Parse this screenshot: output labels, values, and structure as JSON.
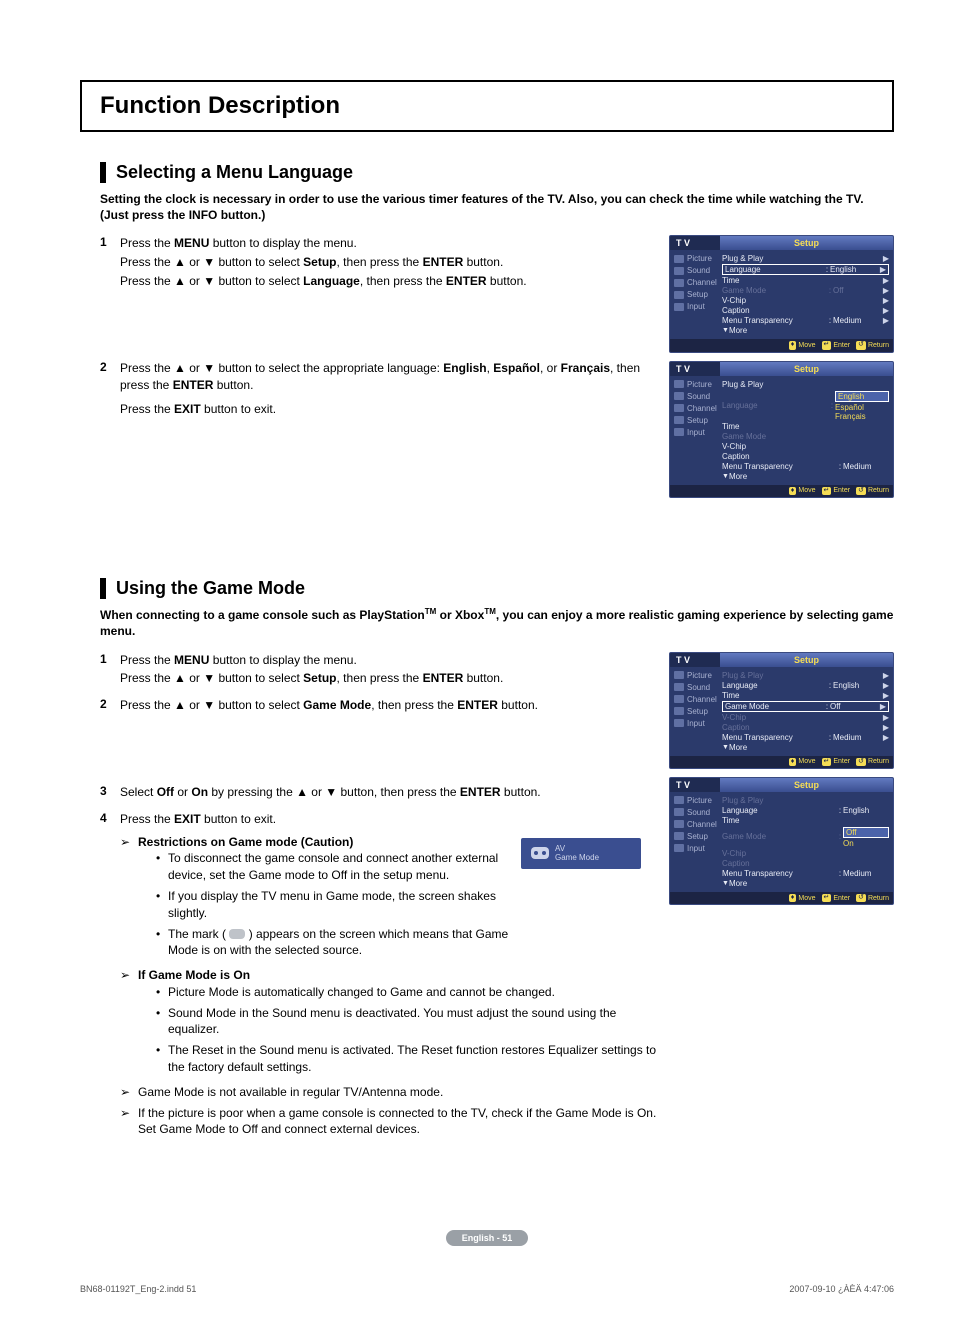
{
  "page_title": "Function Description",
  "section1": {
    "heading": "Selecting a Menu Language",
    "intro": "Setting the clock is necessary in order to use the various timer features of the TV. Also, you can check the time while watching the TV. (Just press the INFO button.)",
    "steps": {
      "s1a": "Press the ",
      "s1b": "MENU",
      "s1c": " button to display the menu.",
      "s1d": "Press the ▲ or ▼ button to select ",
      "s1e": "Setup",
      "s1f": ", then press the ",
      "s1g": "ENTER",
      "s1h": " button.",
      "s1i": "Press the ▲ or ▼ button to select ",
      "s1j": "Language",
      "s1k": ", then press the ",
      "s1l": "ENTER",
      "s1m": " button.",
      "s2a": "Press the ▲ or ▼ button to select the appropriate language: ",
      "s2b": "English",
      "s2c": ", ",
      "s2d": "Español",
      "s2e": ", or ",
      "s2f": "Français",
      "s2g": ", then press the ",
      "s2h": "ENTER",
      "s2i": " button.",
      "s2j": "Press the ",
      "s2k": "EXIT",
      "s2l": " button to exit."
    }
  },
  "section2": {
    "heading": "Using the Game Mode",
    "intro_a": "When connecting to a game console such as PlayStation",
    "intro_tm1": "TM",
    "intro_b": " or Xbox",
    "intro_tm2": "TM",
    "intro_c": ", you can enjoy a more realistic gaming experience by selecting game menu.",
    "steps": {
      "s1a": "Press the ",
      "s1b": "MENU",
      "s1c": " button to display the menu.",
      "s1d": "Press the ▲ or ▼ button to select ",
      "s1e": "Setup",
      "s1f": ", then press the ",
      "s1g": "ENTER",
      "s1h": " button.",
      "s2a": "Press the ▲ or ▼ button to select ",
      "s2b": "Game Mode",
      "s2c": ", then press the ",
      "s2d": "ENTER",
      "s2e": " button.",
      "s3a": "Select ",
      "s3b": "Off",
      "s3c": " or ",
      "s3d": "On",
      "s3e": " by pressing the ▲ or ▼ button, then press the ",
      "s3f": "ENTER",
      "s3g": " button.",
      "s4a": "Press the ",
      "s4b": "EXIT",
      "s4c": " button to exit."
    },
    "sub": {
      "caution_heading": "Restrictions on Game mode (Caution)",
      "c1": "To disconnect the game console and connect another external device, set the Game mode to Off in the setup menu.",
      "c2": "If you display the TV menu in Game mode, the screen shakes slightly.",
      "c3a": "The mark (",
      "c3b": ") appears on the screen which means that Game Mode is on with the selected source.",
      "on_heading": "If Game Mode is On",
      "o1": "Picture Mode is automatically changed to Game and cannot be changed.",
      "o2": "Sound Mode in the Sound menu is deactivated. You must adjust the sound using the equalizer.",
      "o3": "The Reset in the Sound menu is activated. The Reset function restores Equalizer settings to the factory default settings.",
      "n1": "Game Mode is not available in regular TV/Antenna mode.",
      "n2": "If the picture is poor when a game console is connected to the TV, check if the Game Mode is On. Set Game Mode to Off and connect external devices."
    }
  },
  "tv": {
    "tv_label": "T V",
    "setup": "Setup",
    "left": {
      "picture": "Picture",
      "sound": "Sound",
      "channel": "Channel",
      "setup_item": "Setup",
      "input": "Input"
    },
    "rows": {
      "plug": "Plug & Play",
      "language": "Language",
      "english": "English",
      "time": "Time",
      "gamemode": "Game Mode",
      "off": "Off",
      "on": "On",
      "vchip": "V-Chip",
      "caption": "Caption",
      "menu_trans": "Menu Transparency",
      "medium": "Medium",
      "more": "More",
      "espanol": "Español",
      "francais": "Français"
    },
    "foot": {
      "move": "Move",
      "enter": "Enter",
      "return": "Return"
    }
  },
  "badge": {
    "av": "AV",
    "gm": "Game Mode"
  },
  "page_foot": "English - 51",
  "meta": {
    "left": "BN68-01192T_Eng-2.indd   51",
    "right": "2007-09-10   ¿ÀÈÄ 4:47:06"
  }
}
